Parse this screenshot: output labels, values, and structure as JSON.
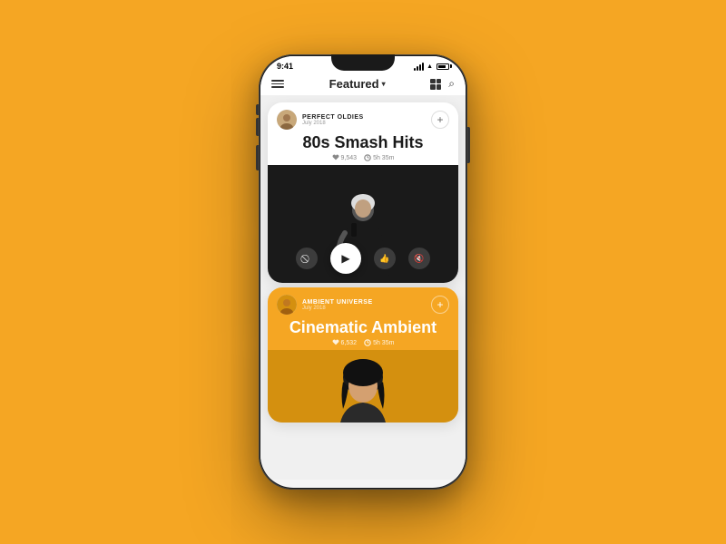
{
  "app": {
    "status_time": "9:41",
    "title": "Featured",
    "title_arrow": "▾"
  },
  "card1": {
    "user_name": "PERFECT OLDIES",
    "user_date": "July 2018",
    "title": "80s Smash Hits",
    "likes": "9,543",
    "duration": "5h 35m",
    "add_label": "+"
  },
  "card2": {
    "user_name": "AMBIENT UNIVERSE",
    "user_date": "July 2018",
    "title": "Cinematic Ambient",
    "likes": "6,532",
    "duration": "5h 35m",
    "add_label": "+"
  }
}
